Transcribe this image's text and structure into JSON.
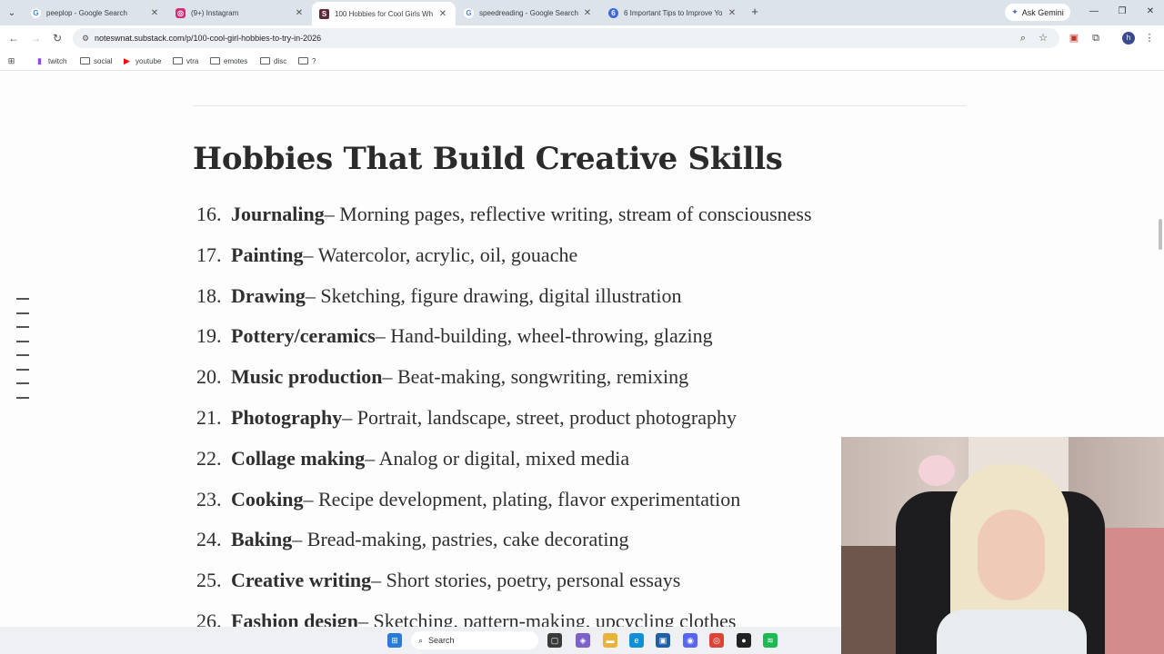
{
  "browser": {
    "tabs": [
      {
        "title": "peeplop - Google Search",
        "favicon": "G",
        "favicon_color": "#4285f4",
        "active": false
      },
      {
        "title": "(9+) Instagram",
        "favicon": "◎",
        "favicon_color": "#d62976",
        "active": false
      },
      {
        "title": "100 Hobbies for Cool Girls Wh",
        "favicon": "S",
        "favicon_color": "#5a2a3a",
        "active": true
      },
      {
        "title": "speedreading - Google Search",
        "favicon": "G",
        "favicon_color": "#4285f4",
        "active": false
      },
      {
        "title": "6 Important Tips to Improve Yo",
        "favicon": "6",
        "favicon_color": "#3b6bd8",
        "active": false
      }
    ],
    "ask_gemini": "Ask Gemini",
    "url": "noteswnat.substack.com/p/100-cool-girl-hobbies-to-try-in-2026",
    "bookmarks": [
      {
        "label": "twitch",
        "icon": "twitch-icon",
        "color": "#9146ff"
      },
      {
        "label": "social",
        "icon": "folder-icon"
      },
      {
        "label": "youtube",
        "icon": "youtube-icon",
        "color": "#ff0000"
      },
      {
        "label": "vtra",
        "icon": "folder-icon"
      },
      {
        "label": "emotes",
        "icon": "folder-icon"
      },
      {
        "label": "disc",
        "icon": "folder-icon"
      },
      {
        "label": "?",
        "icon": "folder-icon"
      }
    ],
    "profile_initial": "h"
  },
  "article": {
    "heading": "Hobbies That Build Creative Skills",
    "items": [
      {
        "num": "16.",
        "name": "Journaling",
        "desc": " – Morning pages, reflective writing, stream of consciousness"
      },
      {
        "num": "17.",
        "name": "Painting",
        "desc": " – Watercolor, acrylic, oil, gouache"
      },
      {
        "num": "18.",
        "name": "Drawing",
        "desc": " – Sketching, figure drawing, digital illustration"
      },
      {
        "num": "19.",
        "name": "Pottery/ceramics",
        "desc": " – Hand-building, wheel-throwing, glazing"
      },
      {
        "num": "20.",
        "name": "Music production",
        "desc": " – Beat-making, songwriting, remixing"
      },
      {
        "num": "21.",
        "name": "Photography",
        "desc": " – Portrait, landscape, street, product photography"
      },
      {
        "num": "22.",
        "name": "Collage making",
        "desc": " – Analog or digital, mixed media"
      },
      {
        "num": "23.",
        "name": "Cooking",
        "desc": " – Recipe development, plating, flavor experimentation"
      },
      {
        "num": "24.",
        "name": "Baking",
        "desc": " – Bread-making, pastries, cake decorating"
      },
      {
        "num": "25.",
        "name": "Creative writing",
        "desc": " – Short stories, poetry, personal essays"
      },
      {
        "num": "26.",
        "name": "Fashion design",
        "desc": " – Sketching, pattern-making, upcycling clothes"
      }
    ]
  },
  "taskbar": {
    "search_label": "Search"
  }
}
